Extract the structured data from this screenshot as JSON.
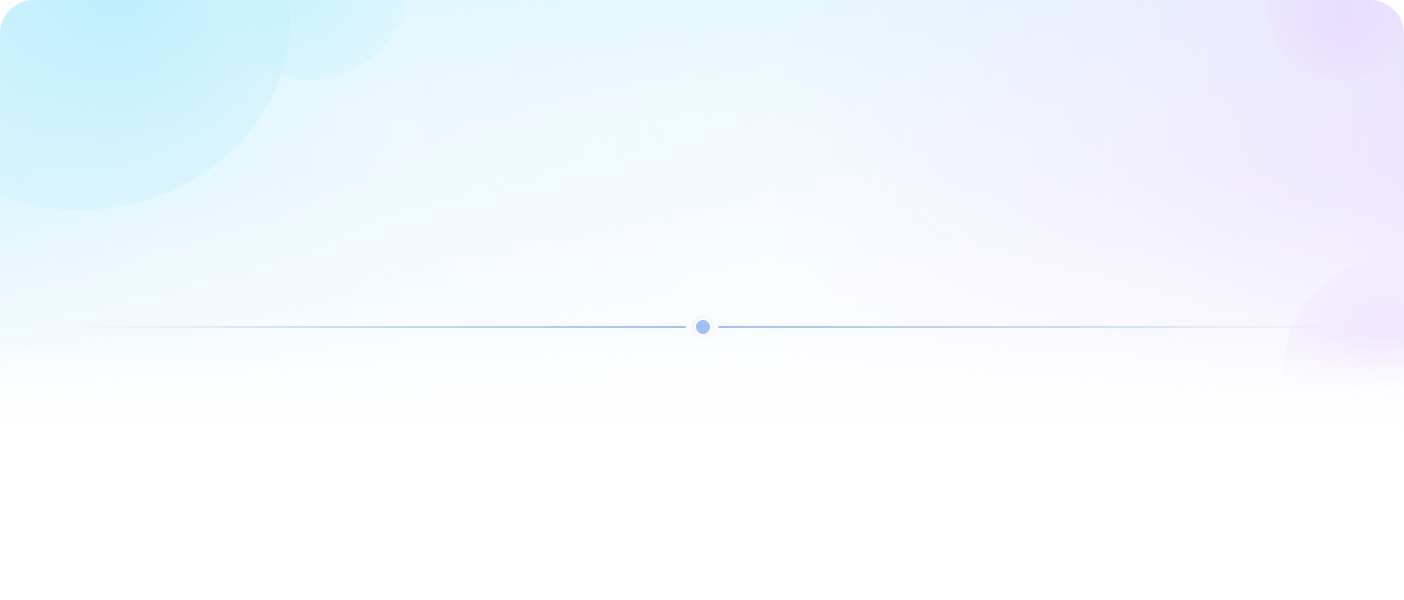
{
  "colors": {
    "cyan_tint": "#c7f0fc",
    "lavender_tint": "#eadefd",
    "divider_line": "#96beee",
    "divider_dot": "#9fc1f5",
    "background": "#ffffff"
  },
  "decorations": {
    "divider": {
      "icon": "dot-icon"
    }
  }
}
